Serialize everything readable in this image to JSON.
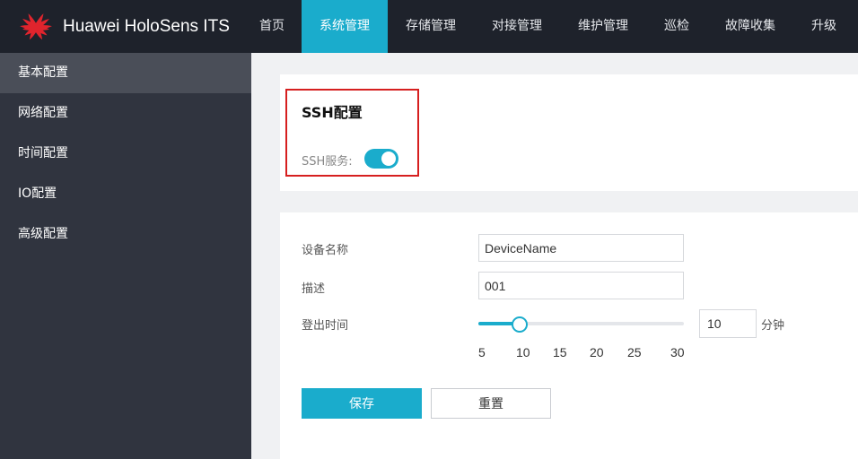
{
  "header": {
    "brand": "Huawei HoloSens ITS",
    "logo_icon": "huawei-flower-logo",
    "nav": [
      {
        "label": "首页"
      },
      {
        "label": "系统管理",
        "active": true
      },
      {
        "label": "存储管理"
      },
      {
        "label": "对接管理"
      },
      {
        "label": "维护管理"
      },
      {
        "label": "巡检"
      },
      {
        "label": "故障收集"
      },
      {
        "label": "升级"
      }
    ]
  },
  "sidebar": {
    "items": [
      {
        "label": "基本配置",
        "active": true
      },
      {
        "label": "网络配置"
      },
      {
        "label": "时间配置"
      },
      {
        "label": "IO配置"
      },
      {
        "label": "高级配置"
      }
    ]
  },
  "ssh": {
    "title": "SSH配置",
    "service_label": "SSH服务:",
    "service_enabled": true
  },
  "form": {
    "device_name_label": "设备名称",
    "device_name_value": "DeviceName",
    "description_label": "描述",
    "description_value": "001",
    "logout_label": "登出时间",
    "logout_value": "10",
    "logout_unit": "分钟",
    "slider": {
      "min": 5,
      "max": 30,
      "value": 10,
      "ticks": [
        "5",
        "10",
        "15",
        "20",
        "25",
        "30"
      ]
    }
  },
  "buttons": {
    "save": "保存",
    "reset": "重置"
  },
  "colors": {
    "accent": "#1aaccc",
    "topbar": "#1e222b",
    "sidebar": "#30343f",
    "highlight_border": "#d61f1f"
  }
}
